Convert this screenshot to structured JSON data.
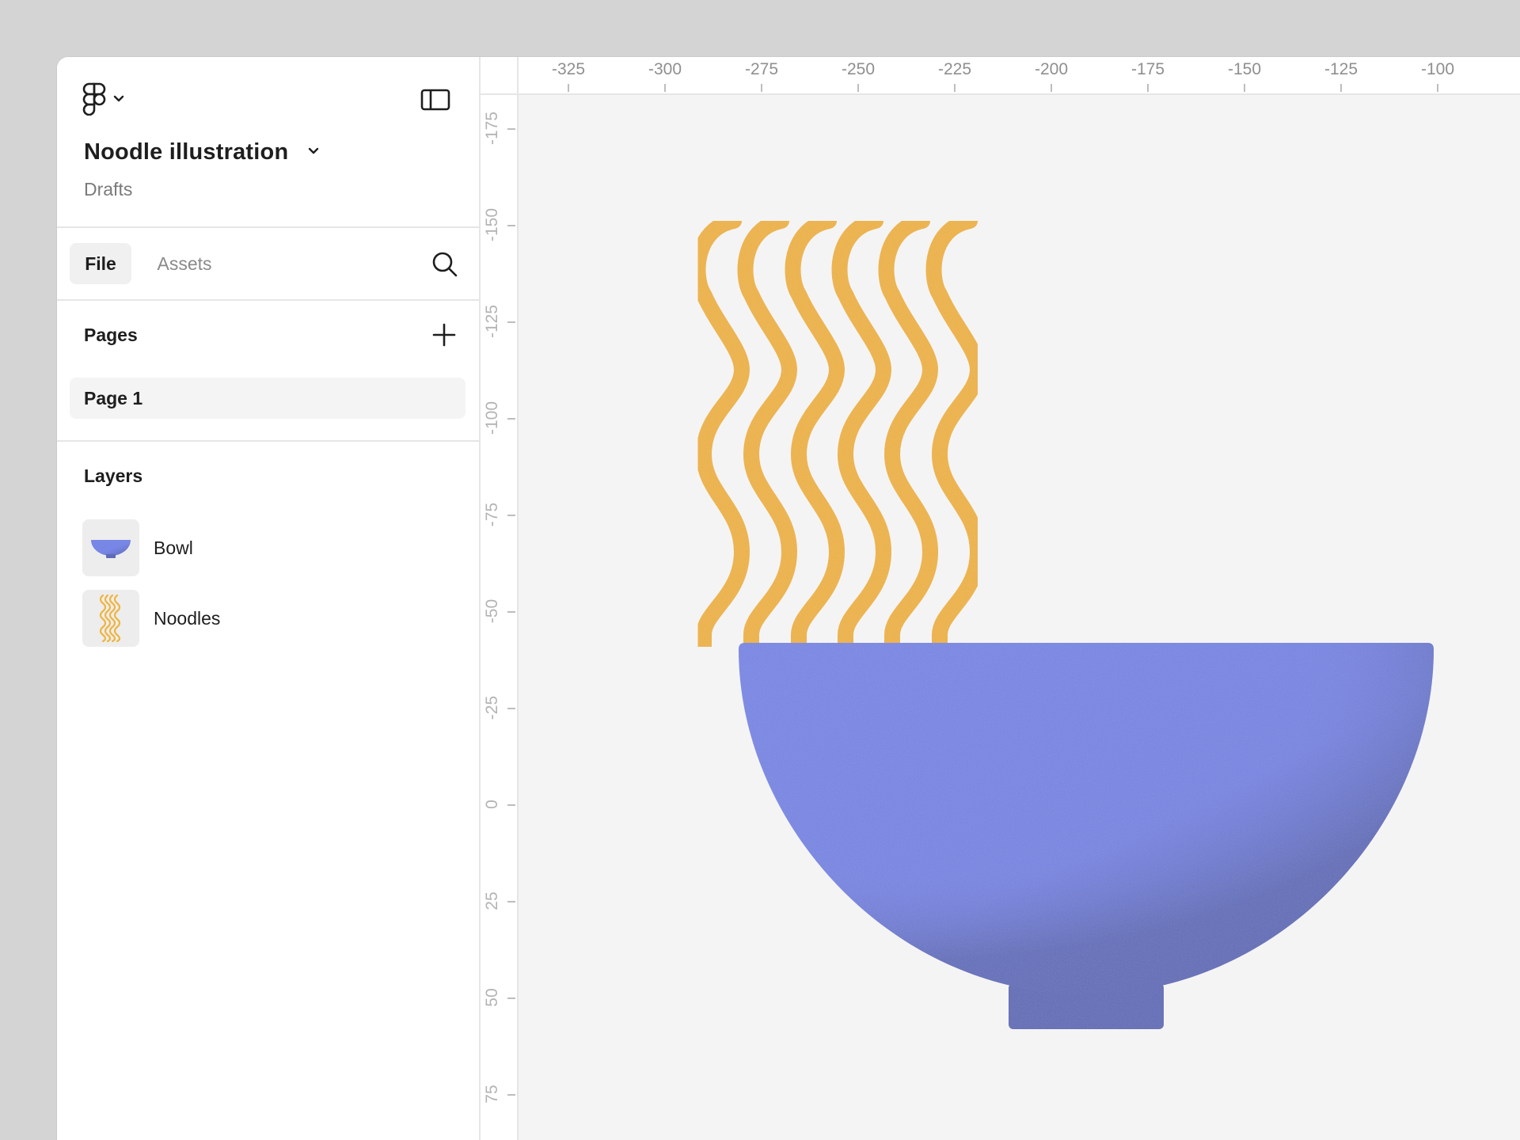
{
  "app": {
    "logo_icon": "figma-logo-icon",
    "menu_icon": "chevron-down-icon",
    "panel_toggle_icon": "sidebar-toggle-icon"
  },
  "file": {
    "title": "Noodle illustration",
    "location": "Drafts"
  },
  "tabs": {
    "file": "File",
    "assets": "Assets"
  },
  "pages": {
    "title": "Pages",
    "items": [
      "Page 1"
    ]
  },
  "layers": {
    "title": "Layers",
    "items": [
      {
        "name": "Bowl",
        "icon": "bowl-thumbnail"
      },
      {
        "name": "Noodles",
        "icon": "noodles-thumbnail"
      }
    ]
  },
  "rulers": {
    "horizontal": [
      "-325",
      "-300",
      "-275",
      "-250",
      "-225",
      "-200",
      "-175",
      "-150",
      "-125",
      "-100"
    ],
    "vertical": [
      "-175",
      "-150",
      "-125",
      "-100",
      "-75",
      "-50",
      "-25",
      "0",
      "25",
      "50",
      "75"
    ]
  },
  "colors": {
    "bowl_light": "#7886e6",
    "bowl_dark": "#5f6bb8",
    "noodle": "#f0b43c",
    "canvas": "#f4f4f4"
  }
}
